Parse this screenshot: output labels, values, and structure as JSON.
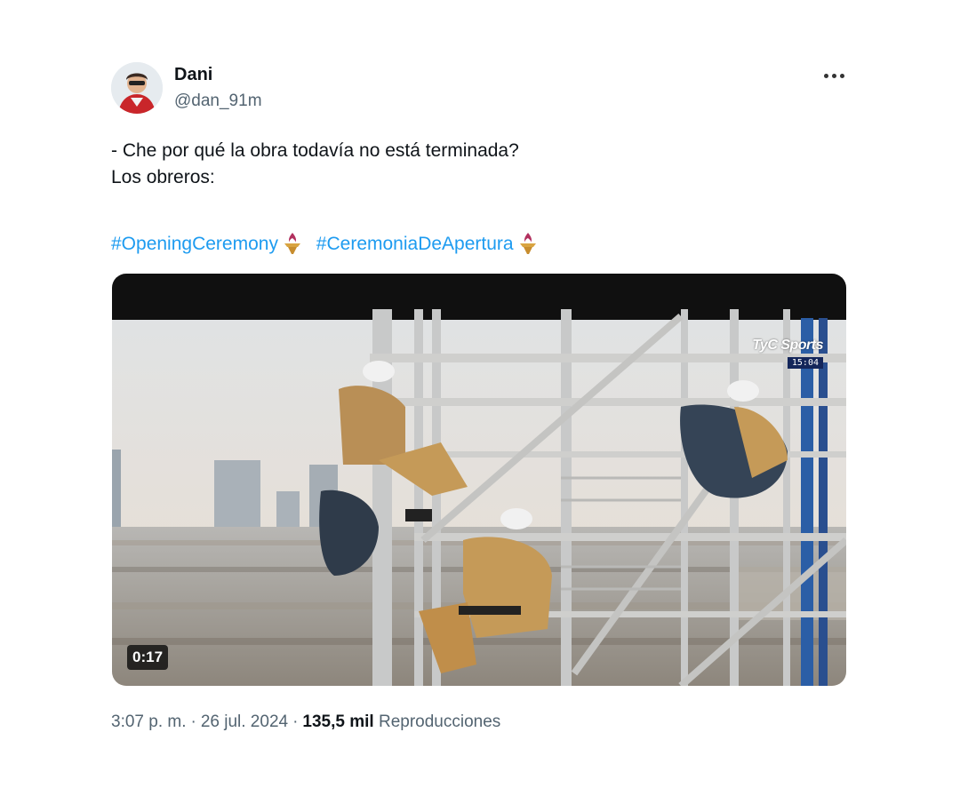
{
  "author": {
    "name": "Dani",
    "handle": "@dan_91m",
    "avatar_icon": "avatar-icon"
  },
  "more_icon": "more-options-icon",
  "tweet": {
    "lines": [
      "- Che por qué la obra todavía no está terminada?",
      "Los obreros:"
    ],
    "hashtags": [
      {
        "text": "#OpeningCeremony",
        "emoji": "olympic-torch-icon"
      },
      {
        "text": "#CeremoniaDeApertura",
        "emoji": "olympic-torch-icon"
      }
    ]
  },
  "video": {
    "duration": "0:17",
    "channel_logo": "TyC Sports",
    "channel_clock": "15:04"
  },
  "meta": {
    "time": "3:07 p. m.",
    "separator": "·",
    "date": "26 jul. 2024",
    "views_count": "135,5 mil",
    "views_label": "Reproducciones"
  },
  "colors": {
    "link": "#1d9bf0",
    "secondary_text": "#536471",
    "primary_text": "#0f1419"
  }
}
